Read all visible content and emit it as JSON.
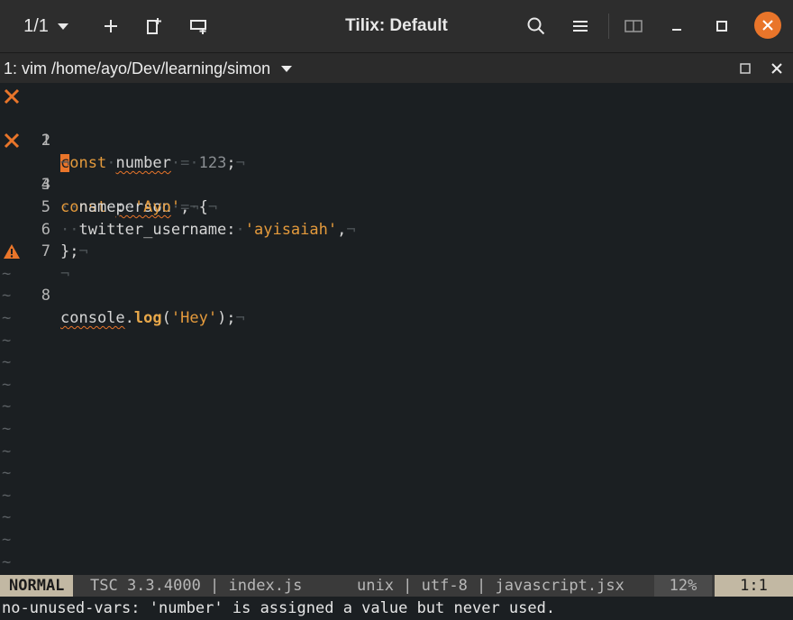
{
  "header": {
    "session_label": "1/1",
    "title": "Tilix: Default"
  },
  "terminal": {
    "title": "1: vim /home/ayo/Dev/learning/simon"
  },
  "editor": {
    "lines": [
      {
        "num": "1",
        "sign": "error"
      },
      {
        "num": "2",
        "sign": ""
      },
      {
        "num": "3",
        "sign": "error"
      },
      {
        "num": "4",
        "sign": ""
      },
      {
        "num": "5",
        "sign": ""
      },
      {
        "num": "6",
        "sign": ""
      },
      {
        "num": "7",
        "sign": ""
      },
      {
        "num": "8",
        "sign": "warning"
      }
    ],
    "tokens": {
      "l1_c": "c",
      "l1_onst": "onst",
      "l1_number": "number",
      "l1_val": "123",
      "l1_semi": ";",
      "l3_const": "const",
      "l3_person": "person",
      "l3_brace": "{",
      "l4_key": "name:",
      "l4_str": "'Ayo'",
      "l4_comma": ",",
      "l5_key": "twitter_username:",
      "l5_str": "'ayisaiah'",
      "l5_comma": ",",
      "l6_close": "};",
      "l8_console": "console",
      "l8_dot": ".",
      "l8_log": "log",
      "l8_open": "(",
      "l8_str": "'Hey'",
      "l8_close": ");",
      "space": "·",
      "eol": "¬",
      "eq": "=",
      "tilde": "~"
    }
  },
  "statusline": {
    "mode": "NORMAL",
    "left": "TSC 3.3.4000 | index.js",
    "right": "unix | utf-8 | javascript.jsx",
    "percent": "12%",
    "position": "1:1"
  },
  "message": "no-unused-vars: 'number' is assigned a value but never used.",
  "colors": {
    "accent": "#e9752a",
    "error": "#e9752a",
    "warning": "#e9752a",
    "keyword": "#e49a3c",
    "background": "#1b1f22"
  }
}
